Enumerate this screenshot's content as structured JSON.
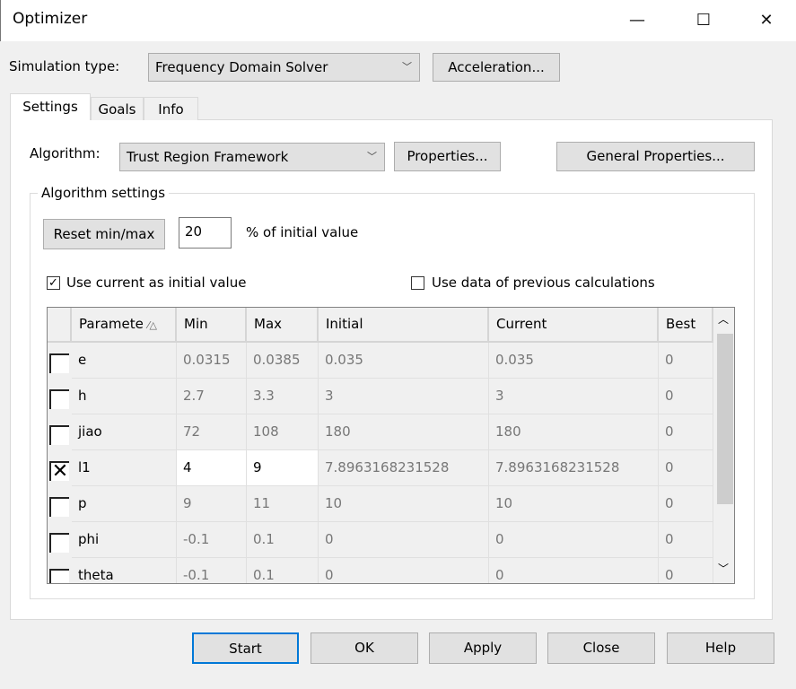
{
  "window": {
    "title": "Optimizer",
    "minimize": "—",
    "maximize": "☐",
    "close": "✕"
  },
  "simulation": {
    "label": "Simulation type:",
    "value": "Frequency Domain Solver",
    "acceleration": "Acceleration..."
  },
  "tabs": [
    {
      "label": "Settings",
      "active": true
    },
    {
      "label": "Goals"
    },
    {
      "label": "Info"
    }
  ],
  "algorithm": {
    "label": "Algorithm:",
    "value": "Trust Region Framework",
    "properties": "Properties...",
    "general_properties": "General Properties..."
  },
  "algorithm_settings": {
    "title": "Algorithm settings",
    "reset": "Reset min/max",
    "percent_value": "20",
    "percent_label": "% of initial value",
    "use_current": {
      "label": "Use current as initial value",
      "checked": true
    },
    "use_previous": {
      "label": "Use data of previous calculations",
      "checked": false
    }
  },
  "table": {
    "columns": [
      "Paramete",
      "Min",
      "Max",
      "Initial",
      "Current",
      "Best"
    ],
    "sort_indicator": "⁄△",
    "rows": [
      {
        "checked": false,
        "name": "e",
        "min": "0.0315",
        "max": "0.0385",
        "initial": "0.035",
        "current": "0.035",
        "best": "0"
      },
      {
        "checked": false,
        "name": "h",
        "min": "2.7",
        "max": "3.3",
        "initial": "3",
        "current": "3",
        "best": "0"
      },
      {
        "checked": false,
        "name": "jiao",
        "min": "72",
        "max": "108",
        "initial": "180",
        "current": "180",
        "best": "0"
      },
      {
        "checked": true,
        "name": "l1",
        "min": "4",
        "max": "9",
        "initial": "7.8963168231528",
        "current": "7.8963168231528",
        "best": "0"
      },
      {
        "checked": false,
        "name": "p",
        "min": "9",
        "max": "11",
        "initial": "10",
        "current": "10",
        "best": "0"
      },
      {
        "checked": false,
        "name": "phi",
        "min": "-0.1",
        "max": "0.1",
        "initial": "0",
        "current": "0",
        "best": "0"
      },
      {
        "checked": false,
        "name": "theta",
        "min": "-0.1",
        "max": "0.1",
        "initial": "0",
        "current": "0",
        "best": "0"
      }
    ]
  },
  "buttons": {
    "start": "Start",
    "ok": "OK",
    "apply": "Apply",
    "close": "Close",
    "help": "Help"
  }
}
